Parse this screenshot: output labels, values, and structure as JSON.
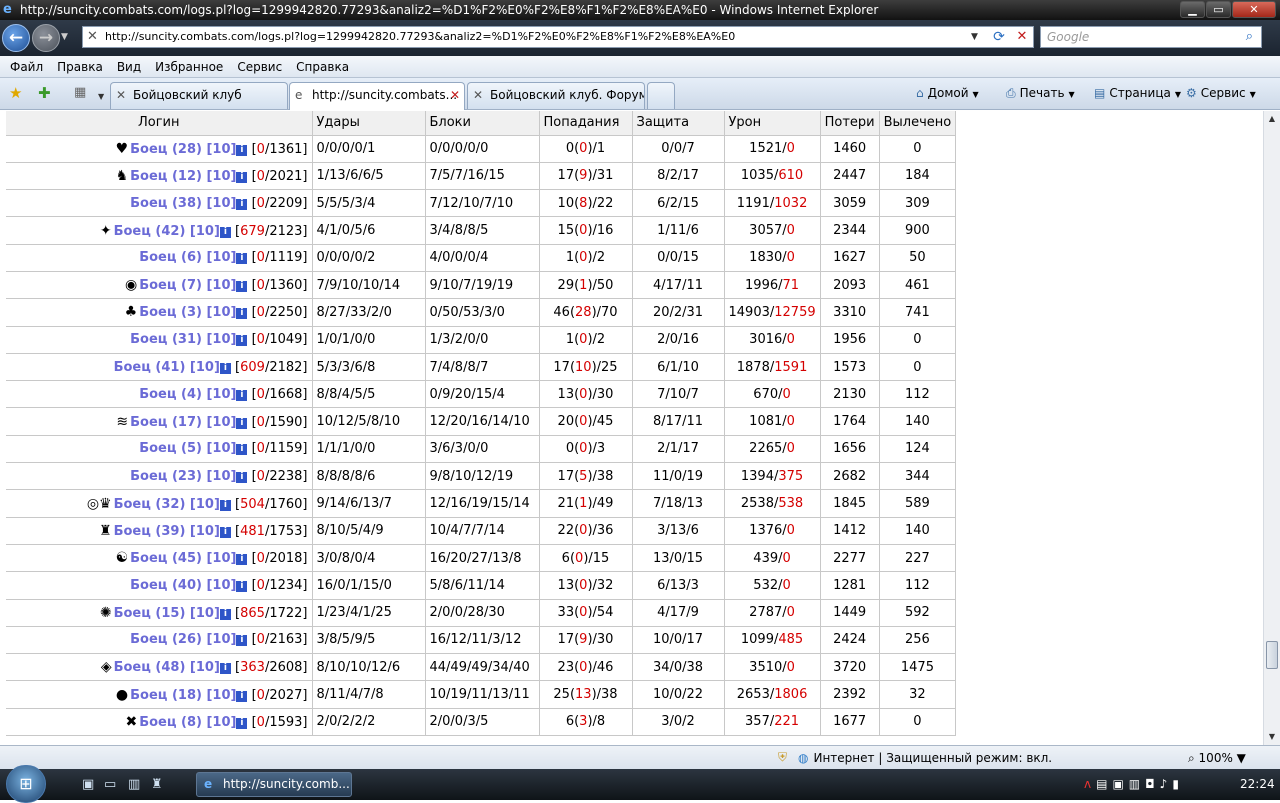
{
  "window": {
    "title": "http://suncity.combats.com/logs.pl?log=1299942820.77293&analiz2=%D1%F2%E0%F2%E8%F1%F2%E8%EA%E0 - Windows Internet Explorer",
    "minimize": "▁",
    "maximize": "▭",
    "close": "✕"
  },
  "address": {
    "url": "http://suncity.combats.com/logs.pl?log=1299942820.77293&analiz2=%D1%F2%E0%F2%E8%F1%F2%E8%EA%E0",
    "search_placeholder": "Google"
  },
  "menu": [
    "Файл",
    "Правка",
    "Вид",
    "Избранное",
    "Сервис",
    "Справка"
  ],
  "tabs": [
    {
      "label": "Бойцовский клуб"
    },
    {
      "label": "http://suncity.combats..."
    },
    {
      "label": "Бойцовский клуб. Форум..."
    }
  ],
  "commands": {
    "home": "Домой",
    "print": "Печать",
    "page": "Страница",
    "tools": "Сервис"
  },
  "table": {
    "headers": [
      "Логин",
      "Удары",
      "Блоки",
      "Попадания",
      "Защита",
      "Урон",
      "Потери",
      "Вылечено"
    ],
    "rows": [
      {
        "pic": "♥",
        "name": "Боец (28) [10]",
        "hp_cur": "0",
        "hp_max": "1361",
        "udar": "0/0/0/0/1",
        "blok": "0/0/0/0/0",
        "pop_a": "0",
        "pop_b": "0",
        "pop_c": "1",
        "zash": "0/0/7",
        "uron_a": "1521",
        "uron_b": "0",
        "poter": "1460",
        "vyl": "0"
      },
      {
        "pic": "♞",
        "name": "Боец (12) [10]",
        "hp_cur": "0",
        "hp_max": "2021",
        "udar": "1/13/6/6/5",
        "blok": "7/5/7/16/15",
        "pop_a": "17",
        "pop_b": "9",
        "pop_c": "31",
        "zash": "8/2/17",
        "uron_a": "1035",
        "uron_b": "610",
        "poter": "2447",
        "vyl": "184"
      },
      {
        "pic": "",
        "name": "Боец (38) [10]",
        "hp_cur": "0",
        "hp_max": "2209",
        "udar": "5/5/5/3/4",
        "blok": "7/12/10/7/10",
        "pop_a": "10",
        "pop_b": "8",
        "pop_c": "22",
        "zash": "6/2/15",
        "uron_a": "1191",
        "uron_b": "1032",
        "poter": "3059",
        "vyl": "309"
      },
      {
        "pic": "✦",
        "name": "Боец (42) [10]",
        "hp_cur": "679",
        "hp_max": "2123",
        "udar": "4/1/0/5/6",
        "blok": "3/4/8/8/5",
        "pop_a": "15",
        "pop_b": "0",
        "pop_c": "16",
        "zash": "1/11/6",
        "uron_a": "3057",
        "uron_b": "0",
        "poter": "2344",
        "vyl": "900"
      },
      {
        "pic": "",
        "name": "Боец (6) [10]",
        "hp_cur": "0",
        "hp_max": "1119",
        "udar": "0/0/0/0/2",
        "blok": "4/0/0/0/4",
        "pop_a": "1",
        "pop_b": "0",
        "pop_c": "2",
        "zash": "0/0/15",
        "uron_a": "1830",
        "uron_b": "0",
        "poter": "1627",
        "vyl": "50"
      },
      {
        "pic": "◉",
        "name": "Боец (7) [10]",
        "hp_cur": "0",
        "hp_max": "1360",
        "udar": "7/9/10/10/14",
        "blok": "9/10/7/19/19",
        "pop_a": "29",
        "pop_b": "1",
        "pop_c": "50",
        "zash": "4/17/11",
        "uron_a": "1996",
        "uron_b": "71",
        "poter": "2093",
        "vyl": "461"
      },
      {
        "pic": "♣",
        "name": "Боец (3) [10]",
        "hp_cur": "0",
        "hp_max": "2250",
        "udar": "8/27/33/2/0",
        "blok": "0/50/53/3/0",
        "pop_a": "46",
        "pop_b": "28",
        "pop_c": "70",
        "zash": "20/2/31",
        "uron_a": "14903",
        "uron_b": "12759",
        "poter": "3310",
        "vyl": "741"
      },
      {
        "pic": "",
        "name": "Боец (31) [10]",
        "hp_cur": "0",
        "hp_max": "1049",
        "udar": "1/0/1/0/0",
        "blok": "1/3/2/0/0",
        "pop_a": "1",
        "pop_b": "0",
        "pop_c": "2",
        "zash": "2/0/16",
        "uron_a": "3016",
        "uron_b": "0",
        "poter": "1956",
        "vyl": "0"
      },
      {
        "pic": "",
        "name": "Боец (41) [10]",
        "hp_cur": "609",
        "hp_max": "2182",
        "udar": "5/3/3/6/8",
        "blok": "7/4/8/8/7",
        "pop_a": "17",
        "pop_b": "10",
        "pop_c": "25",
        "zash": "6/1/10",
        "uron_a": "1878",
        "uron_b": "1591",
        "poter": "1573",
        "vyl": "0"
      },
      {
        "pic": "",
        "name": "Боец (4) [10]",
        "hp_cur": "0",
        "hp_max": "1668",
        "udar": "8/8/4/5/5",
        "blok": "0/9/20/15/4",
        "pop_a": "13",
        "pop_b": "0",
        "pop_c": "30",
        "zash": "7/10/7",
        "uron_a": "670",
        "uron_b": "0",
        "poter": "2130",
        "vyl": "112"
      },
      {
        "pic": "≋",
        "name": "Боец (17) [10]",
        "hp_cur": "0",
        "hp_max": "1590",
        "udar": "10/12/5/8/10",
        "blok": "12/20/16/14/10",
        "pop_a": "20",
        "pop_b": "0",
        "pop_c": "45",
        "zash": "8/17/11",
        "uron_a": "1081",
        "uron_b": "0",
        "poter": "1764",
        "vyl": "140"
      },
      {
        "pic": "",
        "name": "Боец (5) [10]",
        "hp_cur": "0",
        "hp_max": "1159",
        "udar": "1/1/1/0/0",
        "blok": "3/6/3/0/0",
        "pop_a": "0",
        "pop_b": "0",
        "pop_c": "3",
        "zash": "2/1/17",
        "uron_a": "2265",
        "uron_b": "0",
        "poter": "1656",
        "vyl": "124"
      },
      {
        "pic": "",
        "name": "Боец (23) [10]",
        "hp_cur": "0",
        "hp_max": "2238",
        "udar": "8/8/8/8/6",
        "blok": "9/8/10/12/19",
        "pop_a": "17",
        "pop_b": "5",
        "pop_c": "38",
        "zash": "11/0/19",
        "uron_a": "1394",
        "uron_b": "375",
        "poter": "2682",
        "vyl": "344"
      },
      {
        "pic": "◎♛",
        "name": "Боец (32) [10]",
        "hp_cur": "504",
        "hp_max": "1760",
        "udar": "9/14/6/13/7",
        "blok": "12/16/19/15/14",
        "pop_a": "21",
        "pop_b": "1",
        "pop_c": "49",
        "zash": "7/18/13",
        "uron_a": "2538",
        "uron_b": "538",
        "poter": "1845",
        "vyl": "589"
      },
      {
        "pic": "♜",
        "name": "Боец (39) [10]",
        "hp_cur": "481",
        "hp_max": "1753",
        "udar": "8/10/5/4/9",
        "blok": "10/4/7/7/14",
        "pop_a": "22",
        "pop_b": "0",
        "pop_c": "36",
        "zash": "3/13/6",
        "uron_a": "1376",
        "uron_b": "0",
        "poter": "1412",
        "vyl": "140"
      },
      {
        "pic": "☯",
        "name": "Боец (45) [10]",
        "hp_cur": "0",
        "hp_max": "2018",
        "udar": "3/0/8/0/4",
        "blok": "16/20/27/13/8",
        "pop_a": "6",
        "pop_b": "0",
        "pop_c": "15",
        "zash": "13/0/15",
        "uron_a": "439",
        "uron_b": "0",
        "poter": "2277",
        "vyl": "227"
      },
      {
        "pic": "",
        "name": "Боец (40) [10]",
        "hp_cur": "0",
        "hp_max": "1234",
        "udar": "16/0/1/15/0",
        "blok": "5/8/6/11/14",
        "pop_a": "13",
        "pop_b": "0",
        "pop_c": "32",
        "zash": "6/13/3",
        "uron_a": "532",
        "uron_b": "0",
        "poter": "1281",
        "vyl": "112"
      },
      {
        "pic": "✺",
        "name": "Боец (15) [10]",
        "hp_cur": "865",
        "hp_max": "1722",
        "udar": "1/23/4/1/25",
        "blok": "2/0/0/28/30",
        "pop_a": "33",
        "pop_b": "0",
        "pop_c": "54",
        "zash": "4/17/9",
        "uron_a": "2787",
        "uron_b": "0",
        "poter": "1449",
        "vyl": "592"
      },
      {
        "pic": "",
        "name": "Боец (26) [10]",
        "hp_cur": "0",
        "hp_max": "2163",
        "udar": "3/8/5/9/5",
        "blok": "16/12/11/3/12",
        "pop_a": "17",
        "pop_b": "9",
        "pop_c": "30",
        "zash": "10/0/17",
        "uron_a": "1099",
        "uron_b": "485",
        "poter": "2424",
        "vyl": "256"
      },
      {
        "pic": "◈",
        "name": "Боец (48) [10]",
        "hp_cur": "363",
        "hp_max": "2608",
        "udar": "8/10/10/12/6",
        "blok": "44/49/49/34/40",
        "pop_a": "23",
        "pop_b": "0",
        "pop_c": "46",
        "zash": "34/0/38",
        "uron_a": "3510",
        "uron_b": "0",
        "poter": "3720",
        "vyl": "1475"
      },
      {
        "pic": "●",
        "name": "Боец (18) [10]",
        "hp_cur": "0",
        "hp_max": "2027",
        "udar": "8/11/4/7/8",
        "blok": "10/19/11/13/11",
        "pop_a": "25",
        "pop_b": "13",
        "pop_c": "38",
        "zash": "10/0/22",
        "uron_a": "2653",
        "uron_b": "1806",
        "poter": "2392",
        "vyl": "32"
      },
      {
        "pic": "✖",
        "name": "Боец (8) [10]",
        "hp_cur": "0",
        "hp_max": "1593",
        "udar": "2/0/2/2/2",
        "blok": "2/0/0/3/5",
        "pop_a": "6",
        "pop_b": "3",
        "pop_c": "8",
        "zash": "3/0/2",
        "uron_a": "357",
        "uron_b": "221",
        "poter": "1677",
        "vyl": "0"
      }
    ]
  },
  "status": {
    "zone": "Интернет | Защищенный режим: вкл.",
    "zoom": "100%"
  },
  "taskbar": {
    "item": "http://suncity.comb...",
    "clock": "22:24"
  },
  "colors": {
    "name": "#6b6bd6",
    "accent_red": "#d40000",
    "info_blue": "#2e55c8"
  }
}
